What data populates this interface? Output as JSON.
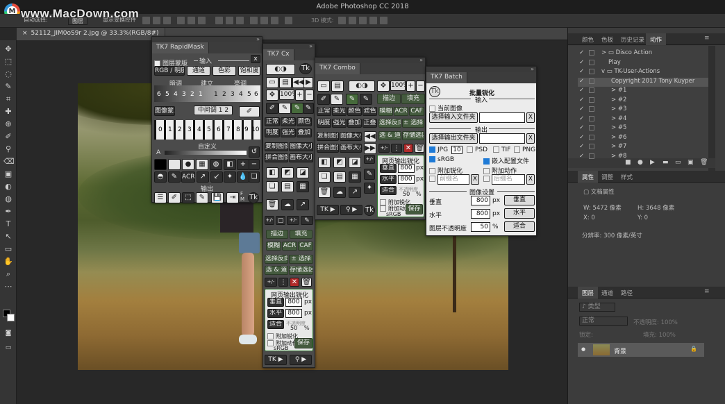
{
  "app": {
    "title": "Adobe Photoshop CC 2018",
    "watermark": "www.MacDown.com",
    "logo_letter": "M"
  },
  "options": {
    "auto_select": "自动选择:",
    "auto_select_value": "图层",
    "show_transform": "显示变换控件",
    "mode_3d": "3D 模式:"
  },
  "document": {
    "tab": "52112_JIM0oS9r 2.jpg @ 33.3%(RGB/8#)",
    "tab_close": "×"
  },
  "tools": [
    "✥",
    "⬚",
    "◌",
    "✎",
    "⌗",
    "✚",
    "⊕",
    "✐",
    "⚲",
    "⌫",
    "▣",
    "◐",
    "◍",
    "✒",
    "T",
    "↖",
    "▭",
    "✋",
    "⌕",
    "⋯"
  ],
  "rapidmask": {
    "title": "TK7 RapidMask",
    "input_label": "输入",
    "layer_mask": "图层蒙版",
    "rgb_lum": "RGB / 明度",
    "channel": "通道",
    "color": "色彩",
    "saturation": "饱和度",
    "dark": "暗调",
    "build": "建立",
    "light": "亮调",
    "nums1": [
      "6",
      "5",
      "4",
      "3",
      "2",
      "1",
      "1",
      "2",
      "3",
      "4",
      "5",
      "6"
    ],
    "mask_layer": "图像蒙版",
    "midtone": "中间调",
    "midtone_nums": [
      "1",
      "2",
      "3"
    ],
    "zone_nums": [
      "0",
      "1",
      "2",
      "3",
      "4",
      "5",
      "6",
      "7",
      "8",
      "9",
      "10"
    ],
    "custom": "自定义",
    "output": "输出",
    "acr": "ACR",
    "ps_letter": "F",
    "m_letter": "M",
    "x_label": "x",
    "minus": "−",
    "plus": "+",
    "a_label": "A"
  },
  "cx": {
    "title": "TK7 Cx",
    "pct": "100%",
    "normal": "正常",
    "soft": "柔光",
    "color": "颜色",
    "brightness": "明度",
    "strong": "强光",
    "overlay": "叠加",
    "copy_img": "复制图像",
    "canvas_size": "图像大小",
    "paste_img": "拼合图像",
    "canvas": "画布大小",
    "stroke": "描边",
    "fill": "填充",
    "blur": "模糊",
    "acr": "ACR",
    "caf": "CAF",
    "sel_rev": "选择反向",
    "pm_sel": "± 选择",
    "sel_and": "选 & 道",
    "save_sel": "存储选区",
    "web_sharpen": "网页输出锐化",
    "vertical": "垂直",
    "v800": "800",
    "horizontal": "水平",
    "h800": "800",
    "px": "px",
    "fit": "适合",
    "opacity": "不透明度",
    "op50": "50",
    "pct_sign": "%",
    "add_sharpen": "附加锐化",
    "add_action": "附加动作",
    "srgb": "sRGB",
    "save": "保存",
    "tk": "TK",
    "tk_arrow": "▶",
    "person_arrow": "▶",
    "plusminus": "+/-"
  },
  "combo": {
    "title": "TK7 Combo",
    "pct": "100%",
    "stroke": "描边",
    "fill": "填充",
    "normal": "正常",
    "soft": "柔光",
    "color": "颜色",
    "filter": "滤色",
    "blur": "模糊",
    "acr": "ACR",
    "caf": "CAF",
    "brightness": "明度",
    "strong": "强光",
    "overlay": "叠加",
    "multiply": "正叠",
    "sel_rev": "选择反向",
    "pm_sel": "± 选择",
    "copy_img": "复制图像",
    "canvas_size": "图像大小",
    "sel_and": "选 & 道",
    "save_sel": "存储选区",
    "paste_img": "拼合图像",
    "canvas": "画布大小",
    "pm": "+/-",
    "web_sharpen": "网页输出锐化",
    "vertical": "垂直",
    "v800": "800",
    "horizontal": "水平",
    "h800": "800",
    "px": "px",
    "fit": "适合",
    "opacity": "不透明度",
    "op50": "50",
    "pct_sign": "%",
    "add_sharpen": "附加锐化",
    "add_action": "附加动加",
    "srgb": "sRGB",
    "save": "保存",
    "tk": "TK",
    "arr1": "▶",
    "arr2": "▶"
  },
  "batch": {
    "title": "TK7 Batch",
    "header": "批量锐化",
    "input": "输入",
    "current_image": "当前图像",
    "select_input": "选择输入文件夹",
    "x": "X",
    "output": "输出",
    "select_output": "选择输出文件夹",
    "jpg": "JPG",
    "jpg_q": "10",
    "psd": "PSD",
    "tif": "TIF",
    "png": "PNG",
    "srgb": "sRGB",
    "embed_profile": "嵌入配置文件",
    "add_sharpen": "附加锐化",
    "add_action": "附加动作",
    "prefix": "前缀名",
    "suffix": "后缀名",
    "image_settings": "图像设置",
    "vertical": "垂直",
    "v800": "800",
    "px": "px",
    "v_btn": "垂直",
    "horizontal": "水平",
    "h800": "800",
    "h_btn": "水平",
    "layer_opacity": "图层不透明度",
    "op50": "50",
    "pct": "%",
    "fit": "适合"
  },
  "right": {
    "tabs1": [
      "颜色",
      "色板",
      "历史记录",
      "动作"
    ],
    "actions": [
      {
        "name": "Disco Action",
        "kind": "folder",
        "exp": ">"
      },
      {
        "name": "Play",
        "kind": "item",
        "exp": ""
      },
      {
        "name": "TK-User-Actions",
        "kind": "folder",
        "exp": "v"
      },
      {
        "name": "Copyright 2017 Tony Kuyper",
        "kind": "item",
        "exp": ""
      },
      {
        "name": "#1",
        "kind": "item",
        "exp": ">"
      },
      {
        "name": "#2",
        "kind": "item",
        "exp": ">"
      },
      {
        "name": "#3",
        "kind": "item",
        "exp": ">"
      },
      {
        "name": "#4",
        "kind": "item",
        "exp": ">"
      },
      {
        "name": "#5",
        "kind": "item",
        "exp": ">"
      },
      {
        "name": "#6",
        "kind": "item",
        "exp": ">"
      },
      {
        "name": "#7",
        "kind": "item",
        "exp": ">"
      },
      {
        "name": "#8",
        "kind": "item",
        "exp": ">"
      }
    ],
    "check": "✓",
    "action_controls": [
      "■",
      "●",
      "▶",
      "▬",
      "▭",
      "▣",
      "🗑"
    ],
    "tabs2": [
      "属性",
      "调整",
      "样式"
    ],
    "doc_props": "文档属性",
    "w": "W: 5472 像素",
    "h": "H: 3648 像素",
    "x": "X: 0",
    "y": "Y: 0",
    "res": "分辨率: 300 像素/英寸",
    "tabs3": [
      "图层",
      "通道",
      "路径"
    ],
    "kind": "♪ 类型",
    "normal": "正常",
    "opacity": "不透明度: 100%",
    "lock": "锁定:",
    "fill": "填充: 100%",
    "layer": "背景",
    "eye": "●",
    "lock_icon": "🔒"
  }
}
